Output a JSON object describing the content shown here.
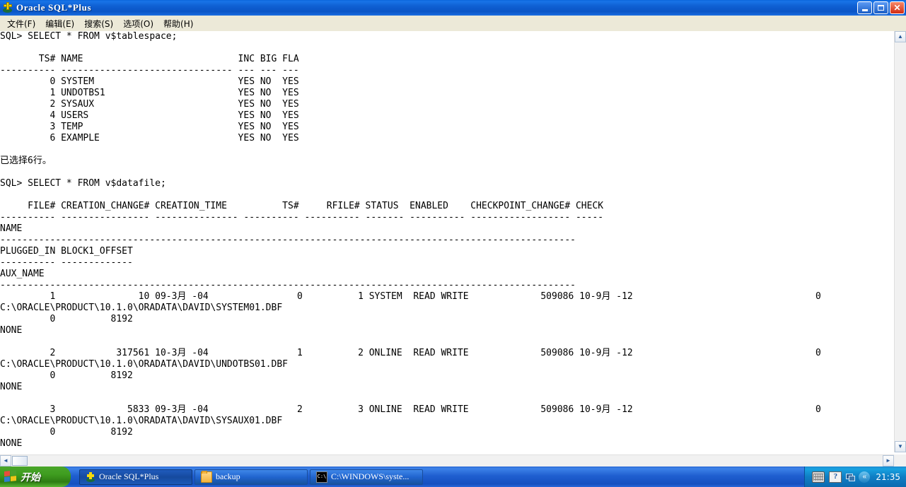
{
  "window": {
    "title": "Oracle SQL*Plus",
    "icon": "oracle-sqlplus-icon",
    "buttons": {
      "minimize": "_",
      "maximize": "□",
      "close": "✕"
    }
  },
  "menubar": {
    "items": [
      {
        "label": "文件(F)",
        "name": "menu-file"
      },
      {
        "label": "编辑(E)",
        "name": "menu-edit"
      },
      {
        "label": "搜索(S)",
        "name": "menu-search"
      },
      {
        "label": "选项(O)",
        "name": "menu-options"
      },
      {
        "label": "帮助(H)",
        "name": "menu-help"
      }
    ]
  },
  "console": {
    "lines": [
      "SQL> SELECT * FROM v$tablespace;",
      "",
      "       TS# NAME                            INC BIG FLA",
      "---------- ------------------------------- --- --- ---",
      "         0 SYSTEM                          YES NO  YES",
      "         1 UNDOTBS1                        YES NO  YES",
      "         2 SYSAUX                          YES NO  YES",
      "         4 USERS                           YES NO  YES",
      "         3 TEMP                            YES NO  YES",
      "         6 EXAMPLE                         YES NO  YES",
      "",
      "已选择6行。",
      "",
      "SQL> SELECT * FROM v$datafile;",
      "",
      "     FILE# CREATION_CHANGE# CREATION_TIME          TS#     RFILE# STATUS  ENABLED    CHECKPOINT_CHANGE# CHECK",
      "---------- ---------------- --------------- ---------- ---------- ------- ---------- ------------------ -----",
      "NAME",
      "--------------------------------------------------------------------------------------------------------",
      "PLUGGED_IN BLOCK1_OFFSET",
      "---------- -------------",
      "AUX_NAME",
      "--------------------------------------------------------------------------------------------------------",
      "         1               10 09-3月 -04                0          1 SYSTEM  READ WRITE             509086 10-9月 -12                                 0",
      "C:\\ORACLE\\PRODUCT\\10.1.0\\ORADATA\\DAVID\\SYSTEM01.DBF",
      "         0          8192",
      "NONE",
      "",
      "         2           317561 10-3月 -04                1          2 ONLINE  READ WRITE             509086 10-9月 -12                                 0",
      "C:\\ORACLE\\PRODUCT\\10.1.0\\ORADATA\\DAVID\\UNDOTBS01.DBF",
      "         0          8192",
      "NONE",
      "",
      "         3             5833 09-3月 -04                2          3 ONLINE  READ WRITE             509086 10-9月 -12                                 0",
      "C:\\ORACLE\\PRODUCT\\10.1.0\\ORADATA\\DAVID\\SYSAUX01.DBF",
      "         0          8192",
      "NONE"
    ]
  },
  "scrollbars": {
    "vertical": {
      "up_arrow": "▲",
      "down_arrow": "▼"
    },
    "horizontal": {
      "left_arrow": "◄",
      "right_arrow": "►"
    }
  },
  "taskbar": {
    "start_label": "开始",
    "tasks": [
      {
        "label": "Oracle SQL*Plus",
        "icon": "oracle-icon",
        "active": true,
        "name": "taskbar-item-oracle-sqlplus"
      },
      {
        "label": "backup",
        "icon": "folder-icon",
        "active": false,
        "name": "taskbar-item-backup"
      },
      {
        "label": "C:\\WINDOWS\\syste...",
        "icon": "cmd-icon",
        "active": false,
        "name": "taskbar-item-windows-system"
      }
    ],
    "tray": {
      "icons": [
        "keyboard-icon",
        "help-icon",
        "network-icon"
      ],
      "help_glyph": "?",
      "cmd_glyph": "C:\\",
      "chevron": "«"
    },
    "clock": "21:35"
  },
  "colors": {
    "titlebar_blue": "#0a55c6",
    "menubar": "#ece9d8",
    "console_bg": "#ffffff",
    "console_fg": "#000000",
    "taskbar_blue": "#1f5fd0",
    "start_green": "#3e9c1f"
  }
}
